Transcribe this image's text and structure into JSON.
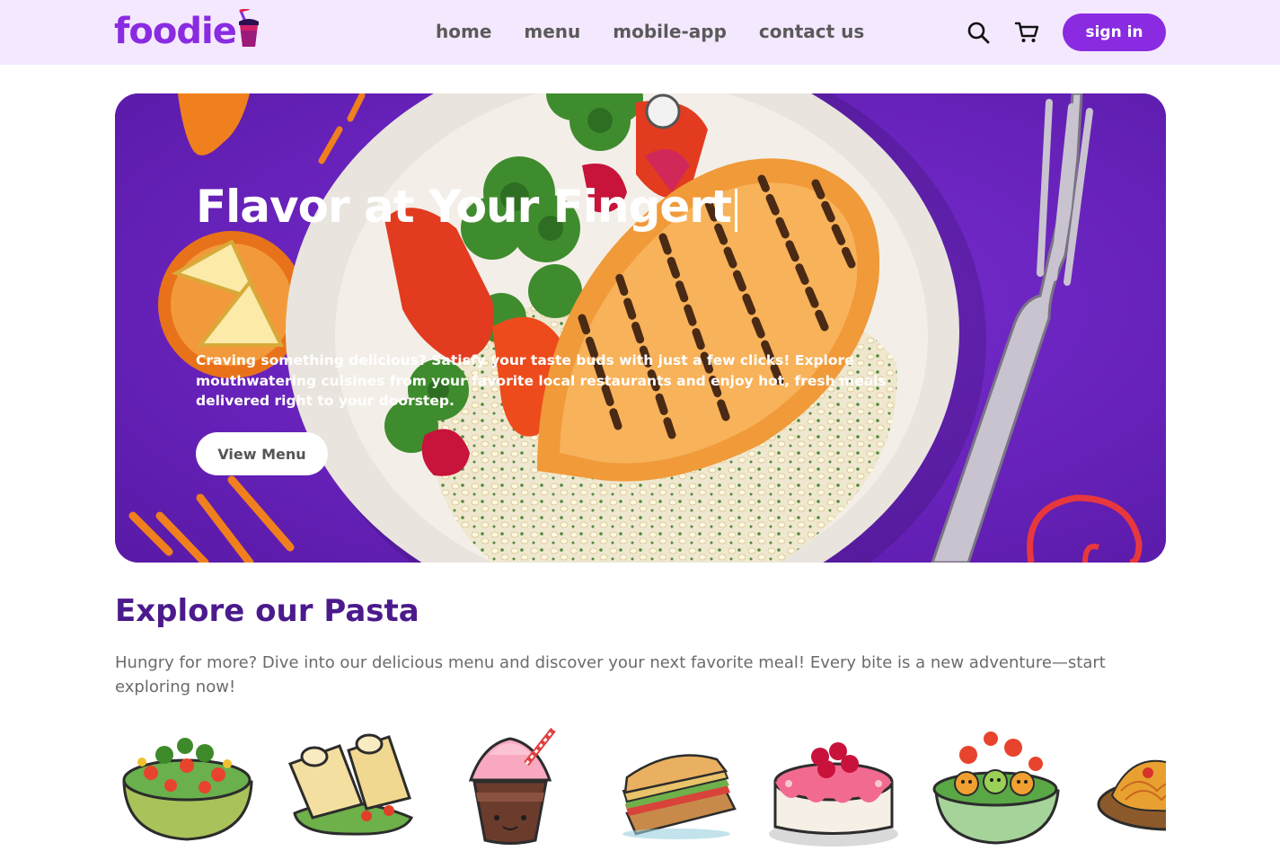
{
  "brand": {
    "name": "foodie",
    "primary": "#8a2be2",
    "nav_bg": "#f4e8ff",
    "heading": "#4b1a8c"
  },
  "nav": {
    "links": [
      "home",
      "menu",
      "mobile-app",
      "contact us"
    ],
    "search_icon": "search-icon",
    "cart_icon": "cart-icon",
    "signin_label": "sign in"
  },
  "hero": {
    "title": "Flavor at Your Fingert",
    "description": "Craving something delicious? Satisfy your taste buds with just a few clicks! Explore mouthwatering cuisines from your favorite local restaurants and enjoy hot, fresh meals delivered right to your doorstep.",
    "button_label": "View Menu"
  },
  "explore": {
    "title": "Explore our Pasta",
    "description": "Hungry for more? Dive into our delicious menu and discover your next favorite meal! Every bite is a new adventure—start exploring now!",
    "items": [
      "salad-bowl-icon",
      "rolls-icon",
      "dessert-shake-icon",
      "sandwich-icon",
      "cake-icon",
      "pure-veg-bowl-icon",
      "pasta-icon"
    ]
  }
}
